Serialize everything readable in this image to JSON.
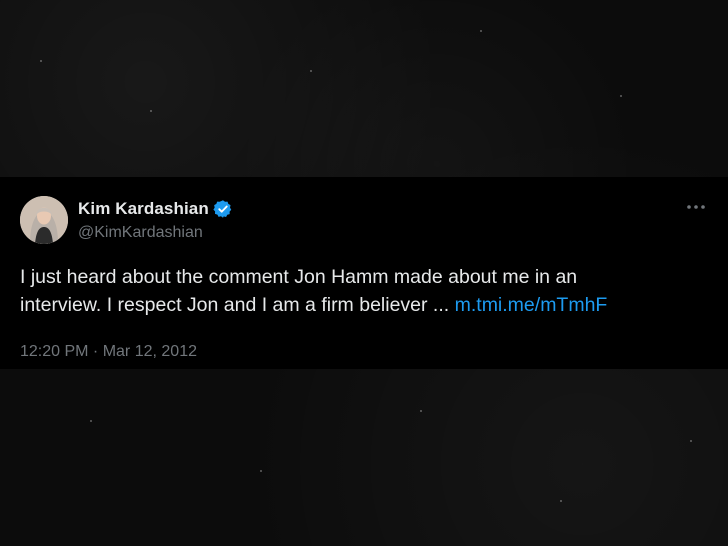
{
  "tweet": {
    "display_name": "Kim Kardashian",
    "handle": "@KimKardashian",
    "text_line1": "I just heard about the comment Jon Hamm made about me in an",
    "text_line2": "interview. I respect Jon and I am a firm believer ...",
    "link_text": "m.tmi.me/mTmhF",
    "timestamp": "12:20 PM · Mar 12, 2012",
    "more_icon": "more-dots-icon",
    "verified_icon": "verified-badge-icon"
  },
  "colors": {
    "background": "#0b0b0b",
    "card": "#000000",
    "text": "#e7e9ea",
    "secondary": "#71767b",
    "link": "#1d9bf0",
    "verified": "#1d9bf0"
  }
}
